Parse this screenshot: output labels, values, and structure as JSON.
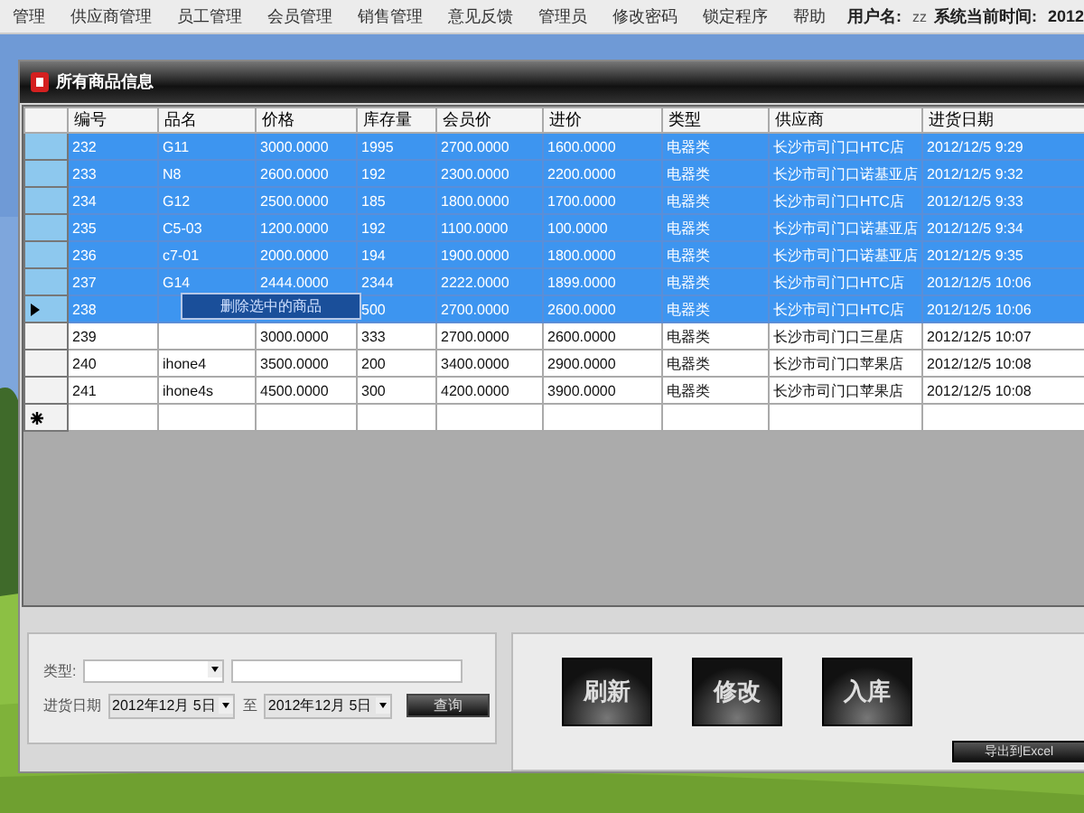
{
  "menu": [
    {
      "label": "管理"
    },
    {
      "label": "供应商管理"
    },
    {
      "label": "员工管理"
    },
    {
      "label": "会员管理"
    },
    {
      "label": "销售管理"
    },
    {
      "label": "意见反馈"
    },
    {
      "label": "管理员"
    },
    {
      "label": "修改密码"
    },
    {
      "label": "锁定程序"
    },
    {
      "label": "帮助"
    }
  ],
  "user": {
    "label": "用户名:",
    "value": "zz"
  },
  "clock": {
    "label": "系统当前时间:",
    "value": "2012"
  },
  "panel": {
    "title": "所有商品信息"
  },
  "table": {
    "columns": [
      "编号",
      "品名",
      "价格",
      "库存量",
      "会员价",
      "进价",
      "类型",
      "供应商",
      "进货日期"
    ],
    "rows": [
      {
        "selected": true,
        "current": false,
        "cells": [
          "232",
          "G11",
          "3000.0000",
          "1995",
          "2700.0000",
          "1600.0000",
          "电器类",
          "长沙市司门口HTC店",
          "2012/12/5 9:29"
        ]
      },
      {
        "selected": true,
        "current": false,
        "cells": [
          "233",
          "N8",
          "2600.0000",
          "192",
          "2300.0000",
          "2200.0000",
          "电器类",
          "长沙市司门口诺基亚店",
          "2012/12/5 9:32"
        ]
      },
      {
        "selected": true,
        "current": false,
        "cells": [
          "234",
          "G12",
          "2500.0000",
          "185",
          "1800.0000",
          "1700.0000",
          "电器类",
          "长沙市司门口HTC店",
          "2012/12/5 9:33"
        ]
      },
      {
        "selected": true,
        "current": false,
        "cells": [
          "235",
          "C5-03",
          "1200.0000",
          "192",
          "1100.0000",
          "100.0000",
          "电器类",
          "长沙市司门口诺基亚店",
          "2012/12/5 9:34"
        ]
      },
      {
        "selected": true,
        "current": false,
        "cells": [
          "236",
          "c7-01",
          "2000.0000",
          "194",
          "1900.0000",
          "1800.0000",
          "电器类",
          "长沙市司门口诺基亚店",
          "2012/12/5 9:35"
        ]
      },
      {
        "selected": true,
        "current": false,
        "cells": [
          "237",
          "G14",
          "2444.0000",
          "2344",
          "2222.0000",
          "1899.0000",
          "电器类",
          "长沙市司门口HTC店",
          "2012/12/5 10:06"
        ]
      },
      {
        "selected": true,
        "current": true,
        "cells": [
          "238",
          null,
          null,
          "500",
          "2700.0000",
          "2600.0000",
          "电器类",
          "长沙市司门口HTC店",
          "2012/12/5 10:06"
        ]
      },
      {
        "selected": false,
        "current": false,
        "cells": [
          "239",
          null,
          "3000.0000",
          "333",
          "2700.0000",
          "2600.0000",
          "电器类",
          "长沙市司门口三星店",
          "2012/12/5 10:07"
        ]
      },
      {
        "selected": false,
        "current": false,
        "cells": [
          "240",
          "ihone4",
          "3500.0000",
          "200",
          "3400.0000",
          "2900.0000",
          "电器类",
          "长沙市司门口苹果店",
          "2012/12/5 10:08"
        ]
      },
      {
        "selected": false,
        "current": false,
        "cells": [
          "241",
          "ihone4s",
          "4500.0000",
          "300",
          "4200.0000",
          "3900.0000",
          "电器类",
          "长沙市司门口苹果店",
          "2012/12/5 10:08"
        ]
      }
    ]
  },
  "context_menu": {
    "items": [
      "删除选中的商品"
    ]
  },
  "filter": {
    "type_label": "类型:",
    "date_label": "进货日期",
    "from": "2012年12月 5日",
    "to_label": "至",
    "to": "2012年12月 5日",
    "search_button": "查询"
  },
  "buttons": [
    "刷新",
    "修改",
    "入库"
  ],
  "export_button": "导出到Excel"
}
